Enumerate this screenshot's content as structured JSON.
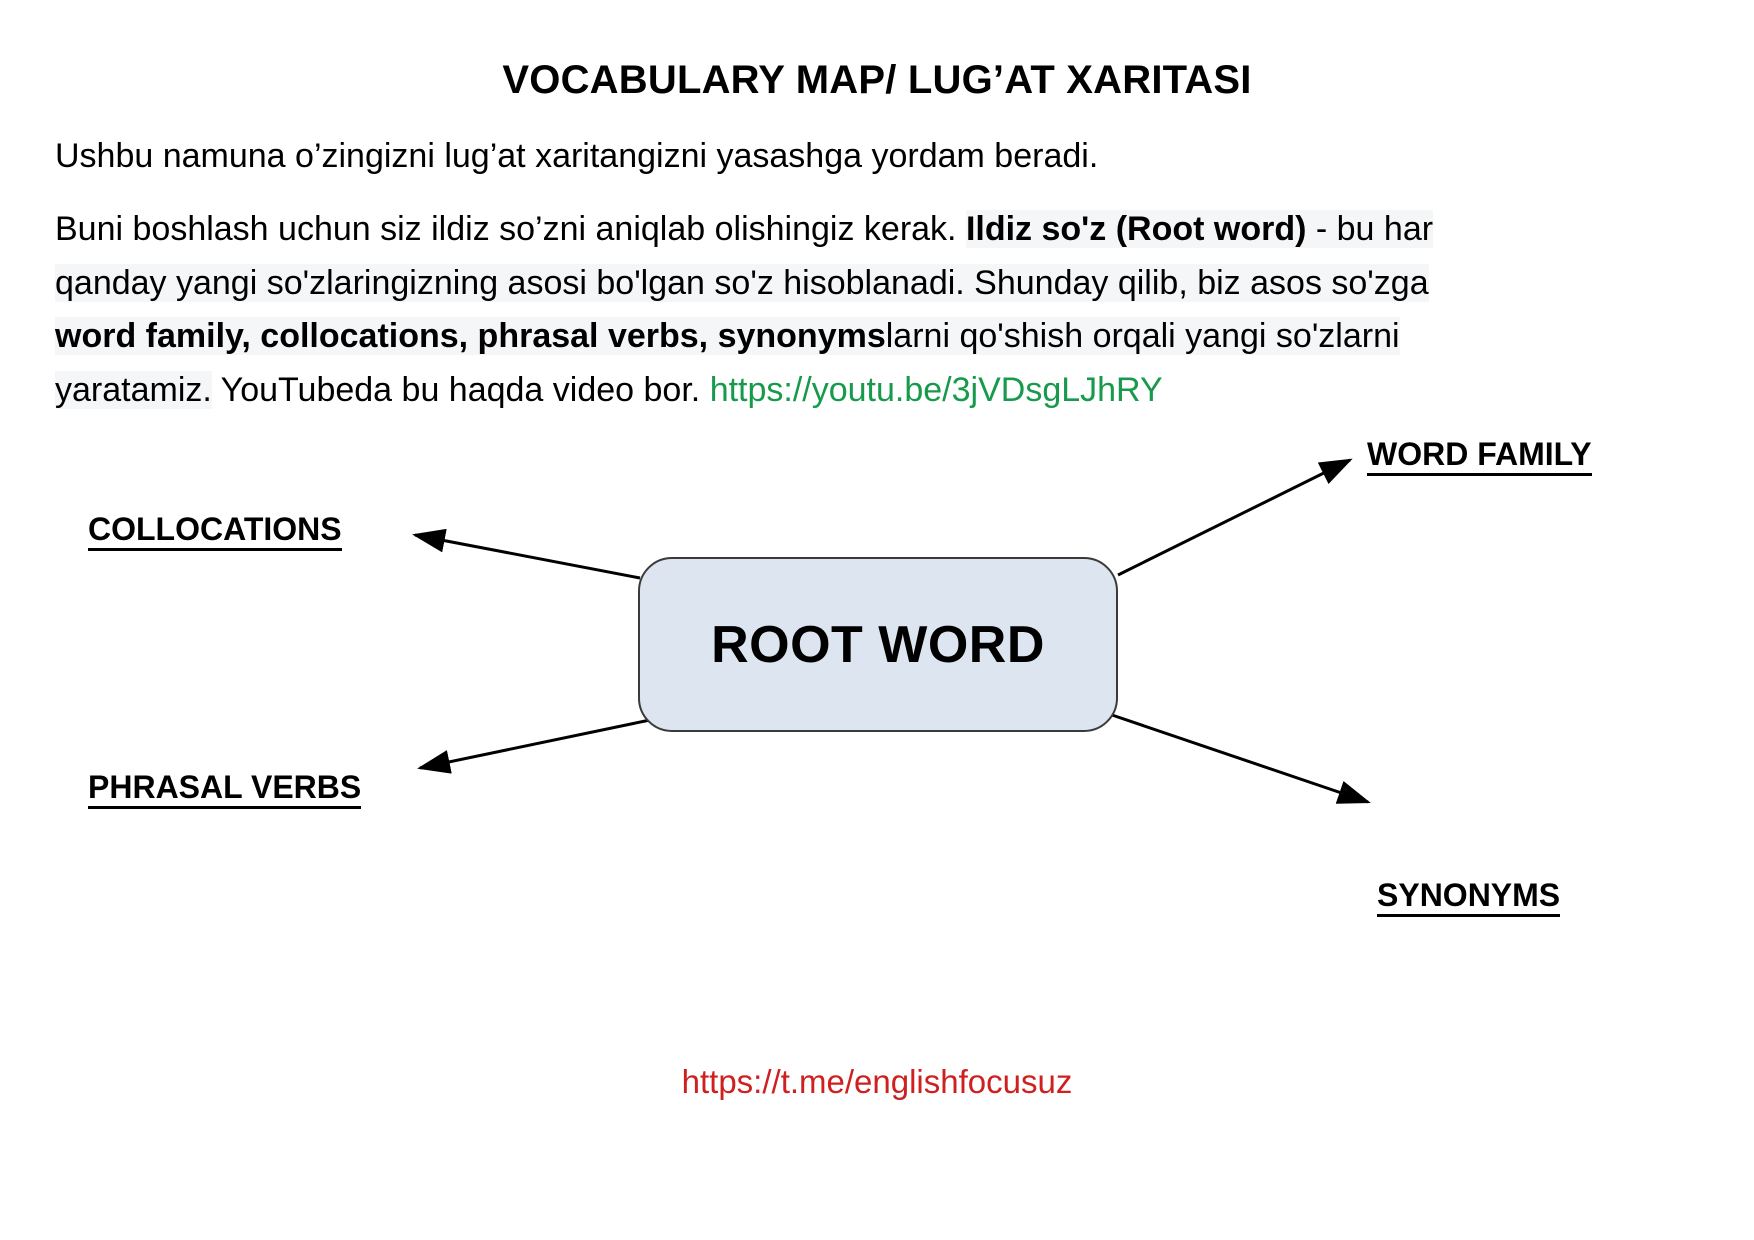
{
  "title": "VOCABULARY MAP/ LUG’AT XARITASI",
  "intro": "Ushbu namuna o’zingizni lug’at xaritangizni yasashga yordam beradi.",
  "paragraph": {
    "seg1": "Buni boshlash uchun siz ildiz so’zni aniqlab olishingiz kerak. ",
    "bold1": "Ildiz so'z (Root word)",
    "seg2": " - bu har qanday yangi so'zlaringizning asosi bo'lgan so'z hisoblanadi. Shunday qilib, biz asos so'zga ",
    "bold2": "word family, collocations, phrasal verbs, synonyms",
    "seg3": "larni qo'shish orqali yangi so'zlarni yaratamiz.",
    "seg4": " YouTubeda bu haqda video bor. ",
    "youtube_link": "https://youtu.be/3jVDsgLJhRY"
  },
  "diagram": {
    "center_node": "ROOT WORD",
    "branches": [
      {
        "label": "WORD FAMILY"
      },
      {
        "label": "COLLOCATIONS"
      },
      {
        "label": "PHRASAL VERBS"
      },
      {
        "label": "SYNONYMS"
      }
    ]
  },
  "footer": {
    "telegram_link": "https://t.me/englishfocusuz"
  },
  "colors": {
    "node_fill": "#dde5f0",
    "node_stroke": "#3a3a3a",
    "link_green": "#189a4c",
    "footer_red": "#cf2020",
    "highlight": "#f5f6f8"
  }
}
